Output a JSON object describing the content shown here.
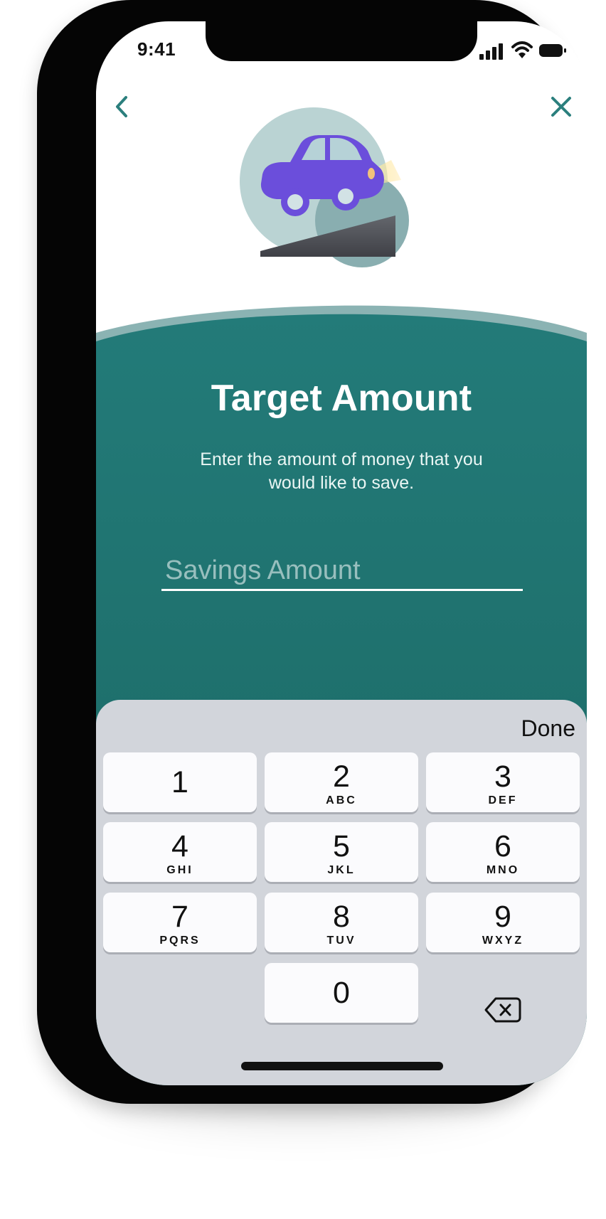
{
  "status_bar": {
    "time": "9:41",
    "icons": [
      "cellular-signal-icon",
      "wifi-icon",
      "battery-icon"
    ]
  },
  "navigation": {
    "back_icon": "chevron-left-icon",
    "close_icon": "close-icon"
  },
  "illustration": {
    "name": "car-on-ramp-illustration"
  },
  "content": {
    "title": "Target Amount",
    "subtitle": "Enter the amount of money that you would like to save."
  },
  "input": {
    "placeholder": "Savings Amount",
    "value": ""
  },
  "keyboard": {
    "done_label": "Done",
    "keys": [
      {
        "number": "1",
        "letters": ""
      },
      {
        "number": "2",
        "letters": "ABC"
      },
      {
        "number": "3",
        "letters": "DEF"
      },
      {
        "number": "4",
        "letters": "GHI"
      },
      {
        "number": "5",
        "letters": "JKL"
      },
      {
        "number": "6",
        "letters": "MNO"
      },
      {
        "number": "7",
        "letters": "PQRS"
      },
      {
        "number": "8",
        "letters": "TUV"
      },
      {
        "number": "9",
        "letters": "WXYZ"
      },
      {
        "number": "0",
        "letters": ""
      }
    ],
    "delete_icon": "delete-backspace-icon"
  },
  "colors": {
    "teal_top": "#237b79",
    "teal_bottom": "#1a6661",
    "teal_accent": "#8bb3b3",
    "car_purple": "#6b4edb",
    "keyboard_background": "#d2d5db"
  }
}
